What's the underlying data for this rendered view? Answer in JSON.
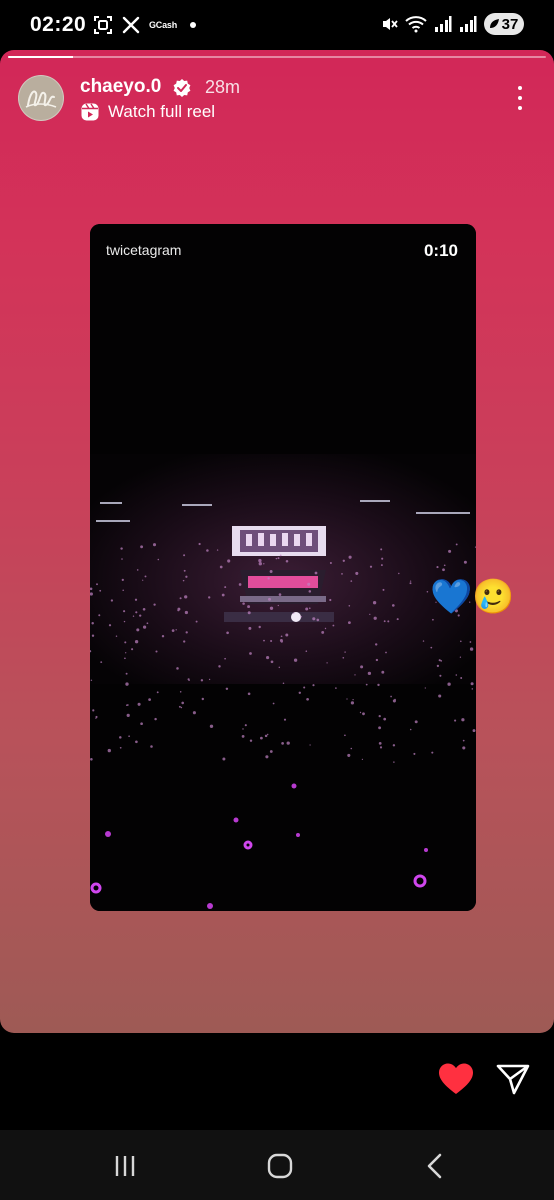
{
  "status_bar": {
    "time": "02:20",
    "left_icons": [
      "screenshot-icon",
      "x-logo-icon",
      "gcash-icon",
      "notification-dot-icon"
    ],
    "gcash_label": "GCash",
    "right_icons": [
      "mute-icon",
      "wifi-icon",
      "signal-icon",
      "signal-icon"
    ],
    "battery_level": "37"
  },
  "story": {
    "progress": 0.12,
    "username": "chaeyo.0",
    "verified": true,
    "time_ago": "28m",
    "reel_link_label": "Watch full reel",
    "reel": {
      "handle": "twicetagram",
      "duration": "0:10"
    },
    "sticker_emojis": "💙🥲"
  },
  "actions": {
    "like_icon": "heart-icon",
    "share_icon": "send-icon",
    "like_color": "#ff3040"
  },
  "nav": {
    "icons": [
      "recents-icon",
      "home-icon",
      "back-icon"
    ]
  }
}
